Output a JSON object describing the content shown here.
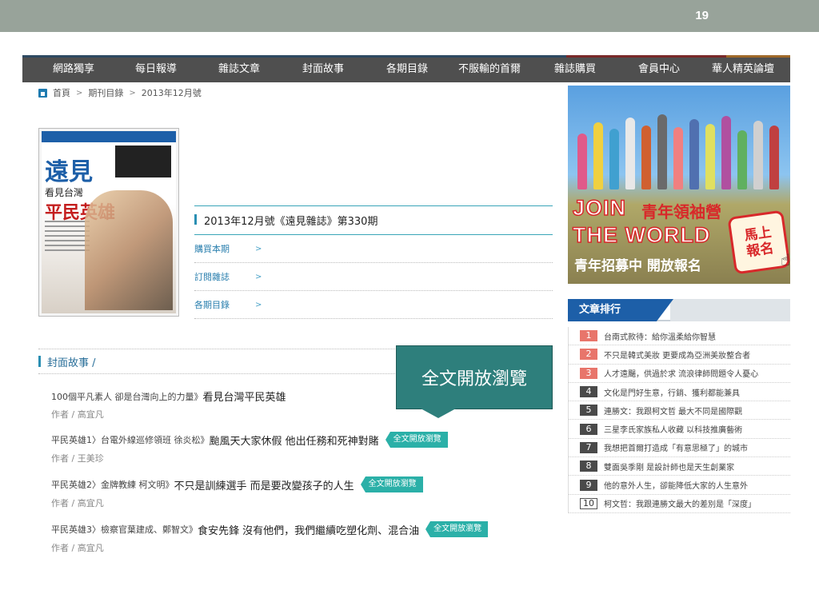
{
  "slide": {
    "number": "19"
  },
  "nav": {
    "items": [
      "網路獨享",
      "每日報導",
      "雜誌文章",
      "封面故事",
      "各期目錄",
      "不服輸的首爾",
      "雜誌購買",
      "會員中心",
      "華人精英論壇"
    ]
  },
  "breadcrumb": {
    "home": "首頁",
    "level1": "期刊目錄",
    "level2": "2013年12月號"
  },
  "cover": {
    "brand": "遠見",
    "tagline": "看見台灣",
    "headline": "平民英雄"
  },
  "issue": {
    "title": "2013年12月號《遠見雜誌》第330期",
    "links": [
      "購買本期",
      "訂閱雜誌",
      "各期目錄"
    ],
    "arrow": ">"
  },
  "section": {
    "title": "封面故事 /"
  },
  "callout": {
    "text": "全文開放瀏覽"
  },
  "articles": [
    {
      "prefix": "100個平凡素人 卻是台灣向上的力量》",
      "title": "看見台灣平民英雄",
      "author": "作者 / 高宜凡",
      "tag": ""
    },
    {
      "prefix": "平民英雄1〉台電外線巡修領班 徐炎松》",
      "title": "颱風天大家休假 他出任務和死神對賭",
      "author": "作者 / 王美珍",
      "tag": "全文開放瀏覽"
    },
    {
      "prefix": "平民英雄2〉金牌教練 柯文明》",
      "title": "不只是訓練選手 而是要改變孩子的人生",
      "author": "作者 / 高宜凡",
      "tag": "全文開放瀏覽"
    },
    {
      "prefix": "平民英雄3〉檢察官葉建成、鄭智文》",
      "title": "食安先鋒 沒有他們，我們繼續吃塑化劑、混合油",
      "author": "作者 / 高宜凡",
      "tag": "全文開放瀏覽"
    }
  ],
  "banner": {
    "line1": "JOIN",
    "line1b": "青年領袖營",
    "line2": "THE WORLD",
    "line3": "青年招募中 開放報名",
    "signup": "馬上報名"
  },
  "ranking": {
    "title": "文章排行",
    "items": [
      {
        "num": "1",
        "text": "台南式款待：給你溫柔給你智慧"
      },
      {
        "num": "2",
        "text": "不只是韓式美妝 更要成為亞洲美妝整合者"
      },
      {
        "num": "3",
        "text": "人才遠颺，供過於求 流浪律師問題令人憂心"
      },
      {
        "num": "4",
        "text": "文化是門好生意，行銷、獲利都能兼具"
      },
      {
        "num": "5",
        "text": "連勝文：我跟柯文哲 最大不同是國際觀"
      },
      {
        "num": "6",
        "text": "三星李氏家族私人收藏 以科技推廣藝術"
      },
      {
        "num": "7",
        "text": "我想把首爾打造成「有意思極了」的城市"
      },
      {
        "num": "8",
        "text": "雙面吳季剛 是設計師也是天生創業家"
      },
      {
        "num": "9",
        "text": "他的意外人生，卻能降低大家的人生意外"
      },
      {
        "num": "10",
        "text": "柯文哲：我跟連勝文最大的差別是「深度」"
      }
    ]
  }
}
